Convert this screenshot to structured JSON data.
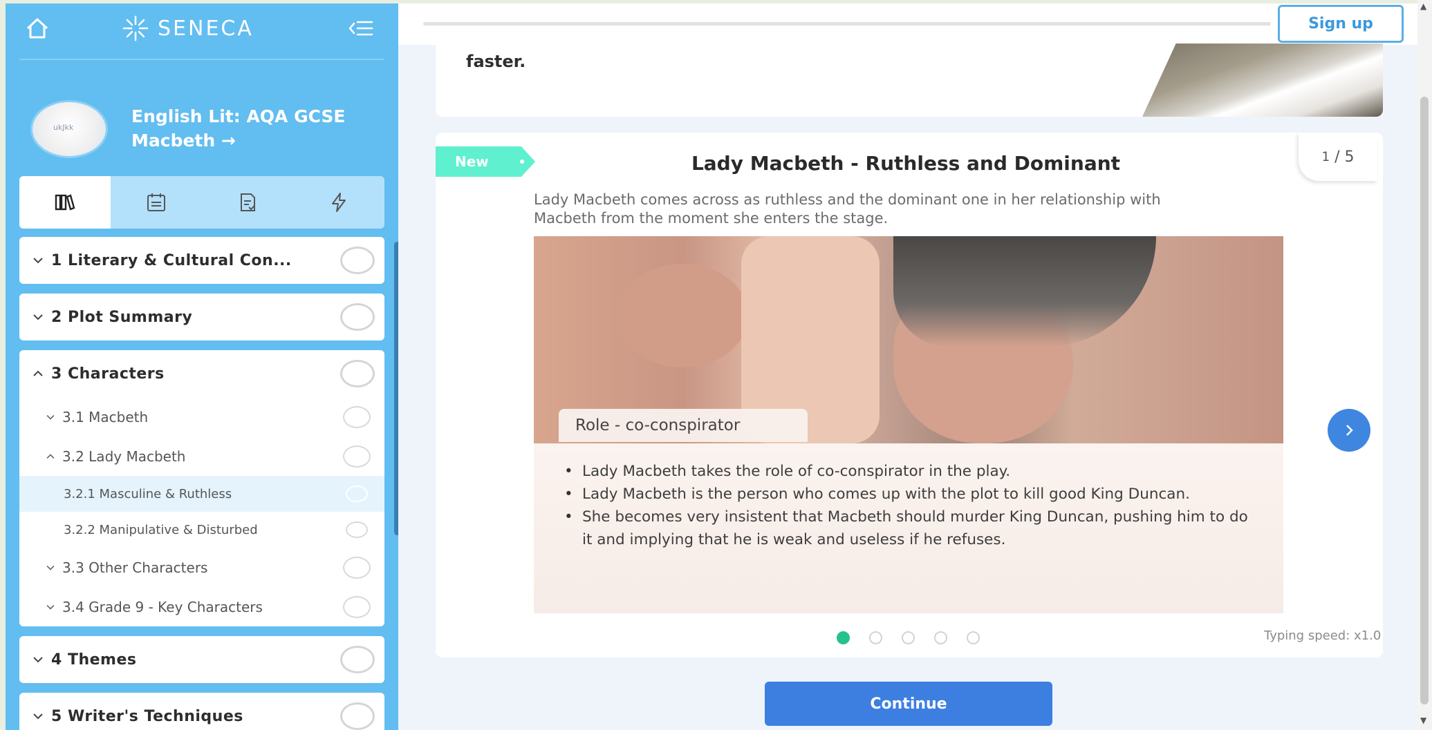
{
  "sidebar": {
    "logo_text": "SENECA",
    "course_title": "English Lit: AQA GCSE Macbeth →",
    "avatar_text": "ukJkk",
    "tabs": [
      "library-icon",
      "calendar-icon",
      "assignment-icon",
      "lightning-icon"
    ],
    "sections": [
      {
        "label": "1 Literary & Cultural Con...",
        "expanded": false
      },
      {
        "label": "2 Plot Summary",
        "expanded": false
      },
      {
        "label": "3 Characters",
        "expanded": true
      },
      {
        "label": "4 Themes",
        "expanded": false
      },
      {
        "label": "5 Writer's Techniques",
        "expanded": false
      }
    ],
    "subsections": [
      {
        "label": "3.1 Macbeth"
      },
      {
        "label": "3.2 Lady Macbeth"
      },
      {
        "label": "3.2.1 Masculine & Ruthless",
        "selected": true
      },
      {
        "label": "3.2.2 Manipulative & Disturbed"
      },
      {
        "label": "3.3 Other Characters"
      },
      {
        "label": "3.4 Grade 9 - Key Characters"
      }
    ]
  },
  "topbar": {
    "signup_label": "Sign up"
  },
  "previous_card": {
    "text": "faster."
  },
  "card": {
    "badge": "New",
    "page_current": "1",
    "page_total": "5",
    "title": "Lady Macbeth - Ruthless and Dominant",
    "description": "Lady Macbeth comes across as ruthless and the dominant one in her relationship with Macbeth from the moment she enters the stage.",
    "role_label": "Role - co-conspirator",
    "bullets": [
      "Lady Macbeth takes the role of co-conspirator in the play.",
      "Lady Macbeth is the person who comes up with the plot to kill good King Duncan.",
      "She becomes very insistent that Macbeth should murder King Duncan, pushing him to do it and implying that he is weak and useless if he refuses."
    ],
    "typing_speed": "Typing speed: x1.0",
    "active_dot": 1
  },
  "continue_label": "Continue",
  "colors": {
    "sidebar": "#62bdf0",
    "accent_blue": "#3d7fe1",
    "badge_green": "#5ff0cf",
    "dot_green": "#27c190"
  }
}
